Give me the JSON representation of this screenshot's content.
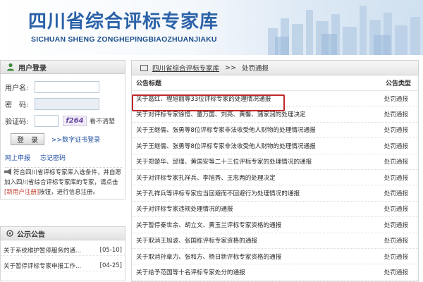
{
  "header": {
    "title": "四川省综合评标专家库",
    "subtitle": "SICHUAN SHENG ZONGHEPINGBIAOZHUANJIAKU"
  },
  "login": {
    "title": "用户登录",
    "username_label": "用户名:",
    "password_label": "密　码:",
    "captcha_label": "验证码:",
    "captcha_value": "f264",
    "captcha_unclear": "看不清楚",
    "login_button": "登　录",
    "cert_login": ">>数字证书登录",
    "link_apply": "网上申报",
    "link_forgot": "忘记密码",
    "note_before": "符合四川省评标专家库入选条件，并自愿加入四川省综合评标专家库的专家，请点击",
    "note_red": "[新用户注册]",
    "note_after": "按钮，进行信息注册。"
  },
  "notices": {
    "title": "公示公告",
    "items": [
      {
        "text": "关于系统维护暂停服务的通...",
        "date": "[05-10]"
      },
      {
        "text": "关于暂停评标专家申报工作...",
        "date": "[04-25]"
      }
    ]
  },
  "breadcrumb": {
    "root": "四川省综合评标专家库",
    "sep": ">>",
    "current": "处罚通报"
  },
  "table": {
    "col_title": "公告标题",
    "col_type": "公告类型",
    "rows": [
      {
        "title": "关于葛红、程旭丽等33位评标专家的处理情况通报",
        "type": "处罚通报"
      },
      {
        "title": "关于对评标专家徐恒、董万国、刘亮、黄馨、蒲家润的处理决定",
        "type": "处罚通报"
      },
      {
        "title": "关于王继儒、张勇等8位评标专家非法收受他人财物的处理情况通报",
        "type": "处罚通报"
      },
      {
        "title": "关于王继儒、张勇等8位评标专家非法收受他人财物的处理情况通报",
        "type": "处罚通报"
      },
      {
        "title": "关于郑楚华、邱瑾、黄国安等二十三位评标专家的处理情况的通报",
        "type": "处罚通报"
      },
      {
        "title": "关于对评标专家孔祥兵、李旭秀、王忠两的处理决定",
        "type": "处罚通报"
      },
      {
        "title": "关于孔祥兵等评标专家应当回避而不回避行为处理情况的通报",
        "type": "处罚通报"
      },
      {
        "title": "关于对评标专家违规处理情况的通报",
        "type": "处罚通报"
      },
      {
        "title": "关于暂停秦世余、胡立文、黄玉兰评标专家资格的通报",
        "type": "处罚通报"
      },
      {
        "title": "关于取消王旭波、张国栋评标专家资格的通报",
        "type": "处罚通报"
      },
      {
        "title": "关于取消孙章力、张和方、杨日新评标专家资格的通报",
        "type": "处罚通报"
      },
      {
        "title": "关于给予范国等十名评标专家处分的通报",
        "type": "处罚通报"
      }
    ]
  },
  "colors": {
    "brand_blue": "#2b62a8",
    "highlight_red": "#c0282a",
    "note_red": "#c0392b"
  }
}
